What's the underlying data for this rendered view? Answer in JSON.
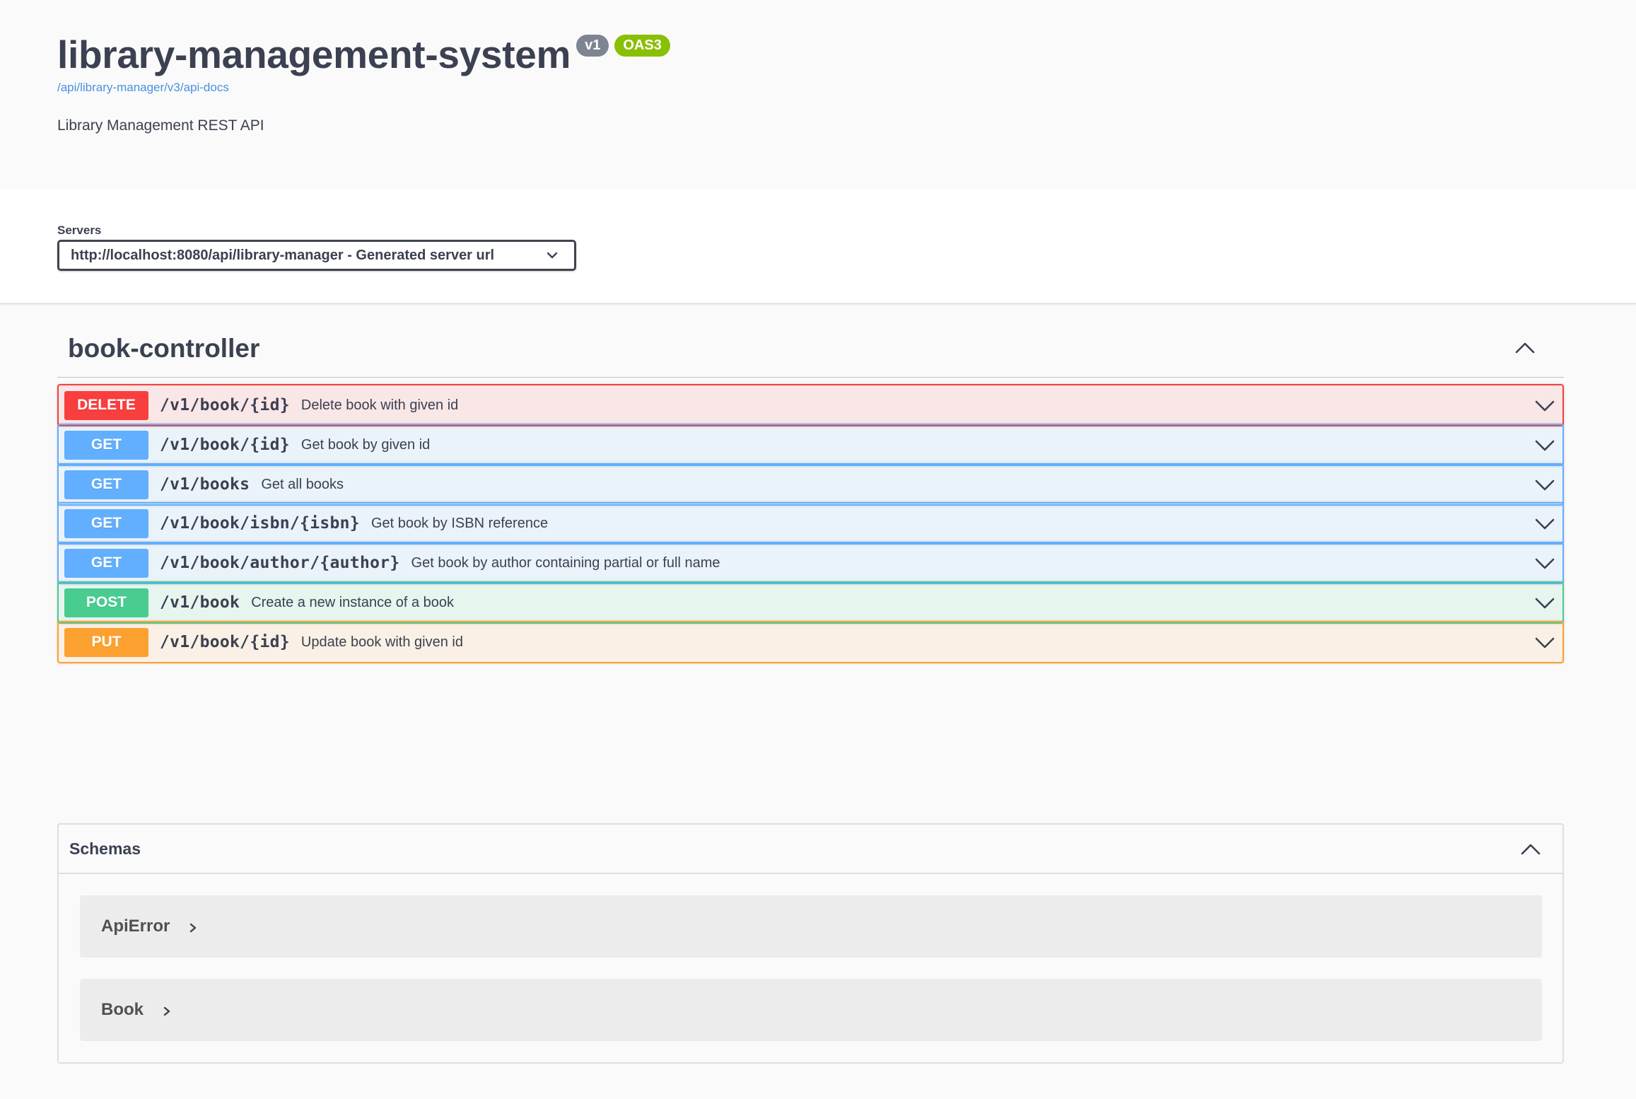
{
  "info": {
    "title": "library-management-system",
    "version_badge": "v1",
    "oas_badge": "OAS3",
    "api_docs_link": "/api/library-manager/v3/api-docs",
    "description": "Library Management REST API"
  },
  "servers": {
    "label": "Servers",
    "selected": "http://localhost:8080/api/library-manager - Generated server url"
  },
  "tag": {
    "name": "book-controller"
  },
  "operations": [
    {
      "method": "DELETE",
      "path": "/v1/book/{id}",
      "summary": "Delete book with given id"
    },
    {
      "method": "GET",
      "path": "/v1/book/{id}",
      "summary": "Get book by given id"
    },
    {
      "method": "GET",
      "path": "/v1/books",
      "summary": "Get all books"
    },
    {
      "method": "GET",
      "path": "/v1/book/isbn/{isbn}",
      "summary": "Get book by ISBN reference"
    },
    {
      "method": "GET",
      "path": "/v1/book/author/{author}",
      "summary": "Get book by author containing partial or full name"
    },
    {
      "method": "POST",
      "path": "/v1/book",
      "summary": "Create a new instance of a book"
    },
    {
      "method": "PUT",
      "path": "/v1/book/{id}",
      "summary": "Update book with given id"
    }
  ],
  "schemas": {
    "title": "Schemas",
    "models": [
      "ApiError",
      "Book"
    ]
  },
  "colors": {
    "delete": "#f93e3e",
    "get": "#61affe",
    "post": "#49cc90",
    "put": "#fca130",
    "text": "#3b4151",
    "link": "#4990e2"
  },
  "icons": {
    "tag_toggle": "chevron-up-icon",
    "operation_toggle": "chevron-down-icon",
    "server_select": "chevron-down-icon",
    "model_expand": "chevron-right-icon"
  }
}
